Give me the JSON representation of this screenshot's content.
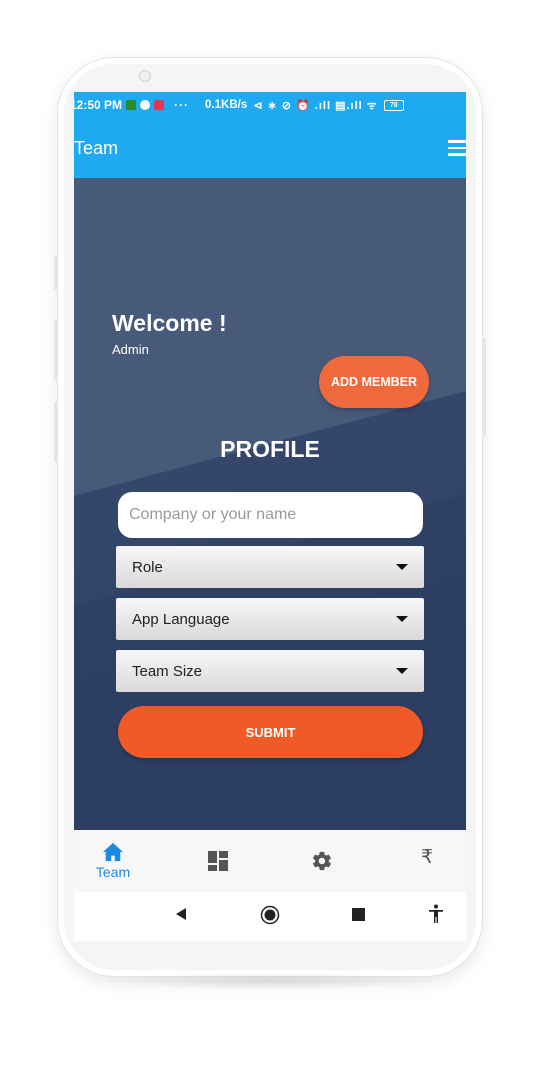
{
  "status_bar": {
    "time": "12:50 PM",
    "dots": "···",
    "speed": "0.1KB/s",
    "icons": "⊲ ∗ ⊘ ⏰ .ıll ▤.ıll ᯤ",
    "battery": "78"
  },
  "app_bar": {
    "title": "Team",
    "menu_icon": "hamburger-icon"
  },
  "main": {
    "welcome": "Welcome !",
    "user": "Admin",
    "add_member_label": "ADD MEMBER",
    "section_title": "PROFILE",
    "name_input": {
      "value": "",
      "placeholder": "Company or your name"
    },
    "selects": {
      "role": "Role",
      "app_language": "App Language",
      "team_size": "Team Size"
    },
    "submit_label": "SUBMIT"
  },
  "bottom_nav": {
    "items": [
      {
        "icon": "home-icon",
        "label": "Team",
        "active": true
      },
      {
        "icon": "dashboard-icon"
      },
      {
        "icon": "gear-icon"
      },
      {
        "icon": "rupee-icon",
        "glyph": "₹"
      }
    ]
  },
  "colors": {
    "app_bar": "#1eaaf1",
    "background_top": "#495b7a",
    "background_bottom": "#2c3e61",
    "accent_orange": "#f05a26",
    "active_tab": "#1e88e5"
  }
}
